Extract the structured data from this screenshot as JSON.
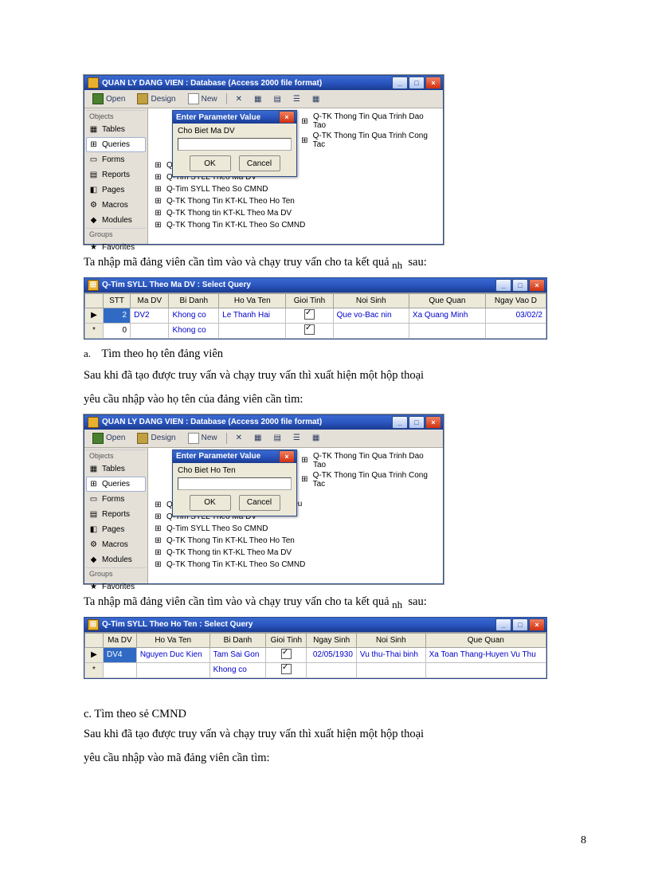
{
  "page_number": "8",
  "screenshot1": {
    "window_title": "QUAN LY DANG VIEN : Database (Access 2000 file format)",
    "toolbar": {
      "open": "Open",
      "design": "Design",
      "new": "New"
    },
    "sidebar": {
      "group1": "Objects",
      "items": [
        "Tables",
        "Queries",
        "Forms",
        "Reports",
        "Pages",
        "Macros",
        "Modules"
      ],
      "group2": "Groups",
      "fav": "Favorites"
    },
    "queries_left": [
      "Q-Tim SYLL Theo Ho Ten",
      "Q-Tim SYLL Theo Ma DV",
      "Q-Tim SYLL Theo So CMND",
      "Q-TK Thong Tin KT-KL Theo Ho Ten",
      "Q-TK Thong tin KT-KL Theo Ma DV",
      "Q-TK Thong Tin KT-KL Theo So CMND"
    ],
    "queries_right": [
      "Q-TK Thong Tin Qua Trinh Dao Tao",
      "Q-TK Thong Tin Qua Trinh Cong Tac"
    ],
    "dialog": {
      "title": "Enter Parameter Value",
      "label": "Cho Biet Ma DV",
      "ok": "OK",
      "cancel": "Cancel"
    }
  },
  "text1": {
    "line": "Ta nhập mã đảng viên cần tìm vào và chạy truy vấn cho ta kết quả",
    "sub": "nh",
    "after": "sau:"
  },
  "queryResult1": {
    "title": "Q-Tim SYLL Theo Ma DV : Select Query",
    "headers": [
      "STT",
      "Ma DV",
      "Bi Danh",
      "Ho Va Ten",
      "Gioi Tinh",
      "Noi Sinh",
      "Que Quan",
      "Ngay Vao D"
    ],
    "rows": [
      {
        "sel": "▶",
        "stt": "2",
        "madv": "DV2",
        "bidanh": "Khong co",
        "hoten": "Le Thanh Hai",
        "gt": true,
        "noisinh": "Que vo-Bac nin",
        "quequan": "Xa Quang Minh",
        "ngay": "03/02/2"
      },
      {
        "sel": "*",
        "stt": "0",
        "madv": "",
        "bidanh": "Khong co",
        "hoten": "",
        "gt": true,
        "noisinh": "",
        "quequan": "",
        "ngay": ""
      }
    ]
  },
  "section_a": {
    "label": "a.",
    "title": "Tìm theo họ tên đảng viên"
  },
  "text2": {
    "line1": "Sau khi đã tạo được truy vấn và chạy truy vấn thì xuất hiện một hộp thoại",
    "line2": "yêu cầu nhập vào họ tên của đảng viên cần tìm:"
  },
  "screenshot2": {
    "dialog": {
      "title": "Enter Parameter Value",
      "label": "Cho Biet Ho Ten",
      "ok": "OK",
      "cancel": "Cancel"
    },
    "extra_item": "leu"
  },
  "text3": {
    "line": "Ta nhập mã đảng viên cần tìm vào và chạy truy vấn cho ta kết quả",
    "sub": "nh",
    "after": "sau:"
  },
  "queryResult2": {
    "title": "Q-Tim SYLL Theo Ho Ten : Select Query",
    "headers": [
      "Ma DV",
      "Ho Va Ten",
      "Bi Danh",
      "Gioi Tinh",
      "Ngay Sinh",
      "Noi Sinh",
      "Que Quan"
    ],
    "rows": [
      {
        "sel": "▶",
        "madv": "DV4",
        "hoten": "Nguyen Duc Kien",
        "bidanh": "Tam Sai Gon",
        "gt": true,
        "ngaysinh": "02/05/1930",
        "noisinh": "Vu thu-Thai binh",
        "quequan": "Xa Toan Thang-Huyen Vu Thu"
      },
      {
        "sel": "*",
        "madv": "",
        "hoten": "",
        "bidanh": "Khong co",
        "gt": true,
        "ngaysinh": "",
        "noisinh": "",
        "quequan": ""
      }
    ]
  },
  "section_c": {
    "label": "c. Tìm theo sẻ CMND"
  },
  "text4": {
    "line1": "Sau khi đã tạo được truy vấn và chạy truy vấn thì xuất hiện một hộp thoại",
    "line2": "yêu cầu nhập vào mã đảng viên cần tìm:"
  }
}
